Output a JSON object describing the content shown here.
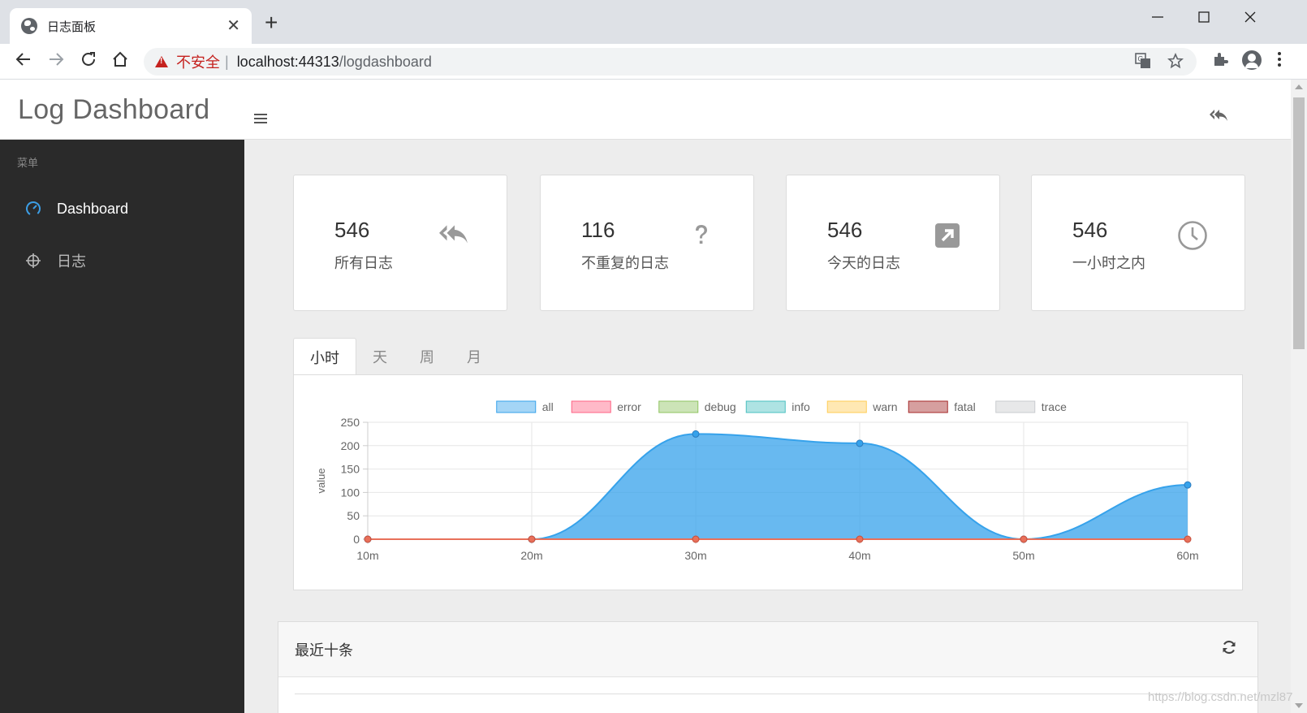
{
  "browser": {
    "tab_title": "日志面板",
    "tab_close": "✕",
    "new_tab": "+",
    "security_label": "不安全",
    "url_host": "localhost:44313",
    "url_path": "/logdashboard",
    "separator": "|"
  },
  "app": {
    "brand": "Log Dashboard"
  },
  "sidebar": {
    "heading": "菜单",
    "items": [
      {
        "label": "Dashboard",
        "icon": "dashboard-icon",
        "active": true
      },
      {
        "label": "日志",
        "icon": "crosshairs-icon",
        "active": false
      }
    ]
  },
  "stats": [
    {
      "value": "546",
      "label": "所有日志",
      "icon": "reply-all-icon"
    },
    {
      "value": "116",
      "label": "不重复的日志",
      "icon": "question-icon"
    },
    {
      "value": "546",
      "label": "今天的日志",
      "icon": "external-link-square-icon"
    },
    {
      "value": "546",
      "label": "一小时之内",
      "icon": "clock-icon"
    }
  ],
  "period_tabs": [
    "小时",
    "天",
    "周",
    "月"
  ],
  "chart_data": {
    "type": "area",
    "ylabel": "value",
    "categories": [
      "10m",
      "20m",
      "30m",
      "40m",
      "50m",
      "60m"
    ],
    "ylim": [
      0,
      250
    ],
    "yticks": [
      0,
      50,
      100,
      150,
      200,
      250
    ],
    "grid": true,
    "legend_position": "top",
    "series": [
      {
        "name": "all",
        "values": [
          0,
          0,
          225,
          205,
          0,
          116
        ],
        "color": "#36a2eb"
      },
      {
        "name": "error",
        "values": [
          0,
          0,
          0,
          0,
          0,
          0
        ],
        "color": "#ff6384"
      },
      {
        "name": "debug",
        "values": [
          0,
          0,
          0,
          0,
          0,
          0
        ],
        "color": "#8fc460"
      },
      {
        "name": "info",
        "values": [
          0,
          0,
          0,
          0,
          0,
          0
        ],
        "color": "#4bc0c0"
      },
      {
        "name": "warn",
        "values": [
          0,
          0,
          0,
          0,
          0,
          0
        ],
        "color": "#ffcd56"
      },
      {
        "name": "fatal",
        "values": [
          0,
          0,
          0,
          0,
          0,
          0
        ],
        "color": "#a52a2a"
      },
      {
        "name": "trace",
        "values": [
          0,
          0,
          0,
          0,
          0,
          0
        ],
        "color": "#c9cbcf"
      }
    ]
  },
  "recent": {
    "title": "最近十条"
  },
  "watermark": "https://blog.csdn.net/mzl87"
}
